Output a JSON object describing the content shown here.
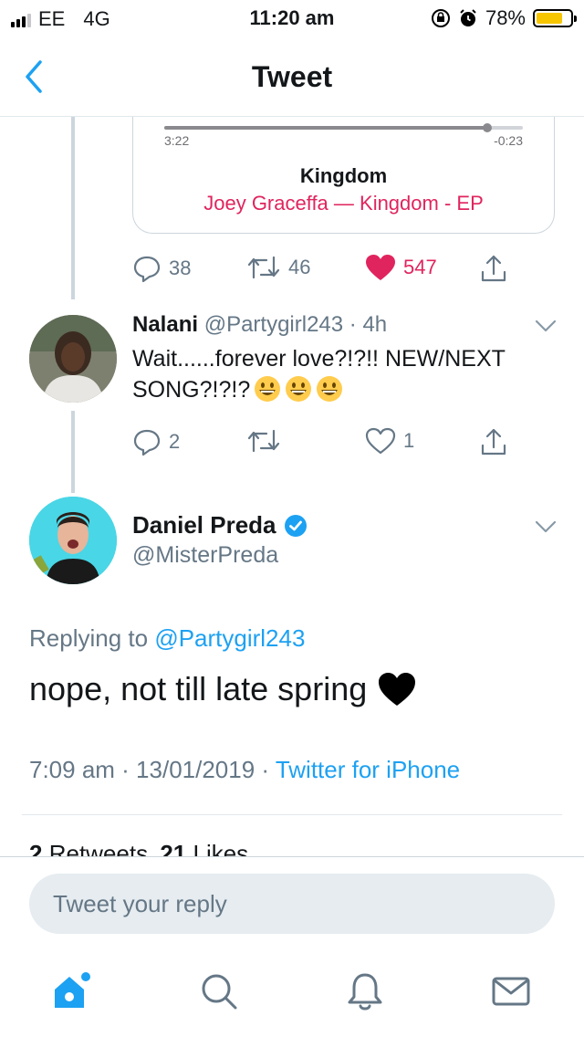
{
  "status_bar": {
    "carrier": "EE",
    "network": "4G",
    "time": "11:20 am",
    "battery_percent": "78%",
    "battery_level": 0.78,
    "battery_color": "#f7c600"
  },
  "nav": {
    "title": "Tweet",
    "back_icon": "chevron-left-icon"
  },
  "music_card": {
    "elapsed": "3:22",
    "remaining": "-0:23",
    "progress": 0.9,
    "title": "Kingdom",
    "artist_album": "Joey Graceffa — Kingdom - EP"
  },
  "parent_tweet_actions": {
    "replies": "38",
    "retweets": "46",
    "likes": "547"
  },
  "reply_tweet": {
    "name": "Nalani",
    "handle_time": "@Partygirl243 · 4h",
    "text": "Wait......forever love?!?!! NEW/NEXT SONG?!?!?",
    "emojis": [
      "grinning-face",
      "grinning-face",
      "grinning-face"
    ],
    "actions": {
      "replies": "2",
      "retweets": "",
      "likes": "1"
    }
  },
  "main_tweet": {
    "name": "Daniel Preda",
    "handle": "@MisterPreda",
    "verified": true,
    "replying_prefix": "Replying to",
    "replying_to": "@Partygirl243",
    "text": "nope, not till late spring",
    "emoji": "black-heart",
    "timestamp": "7:09 am · 13/01/2019 · ",
    "source": "Twitter for iPhone",
    "stats_retweets": "2",
    "stats_retweets_label": "Retweets",
    "stats_likes": "21",
    "stats_likes_label": "Likes"
  },
  "reply_bar": {
    "placeholder": "Tweet your reply"
  },
  "tab_bar": {
    "tabs": [
      "home-icon",
      "search-icon",
      "notifications-icon",
      "messages-icon"
    ]
  },
  "colors": {
    "accent": "#1da1f2",
    "like": "#e0245e",
    "muted": "#657786"
  }
}
